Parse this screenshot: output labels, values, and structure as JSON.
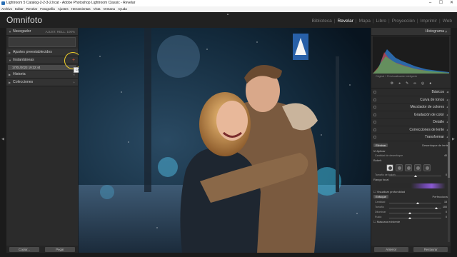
{
  "window": {
    "title": "Lightroom 5 Catalog-2-2-3-2.lrcat - Adobe Photoshop Lightroom Classic - Revelar",
    "controls": [
      "–",
      "☐",
      "✕"
    ]
  },
  "menu": [
    "Archivo",
    "Editar",
    "Revelar",
    "Fotografía",
    "Ajustes",
    "Herramientas",
    "Vista",
    "Ventana",
    "Ayuda"
  ],
  "brand": "Omnifoto",
  "modules": [
    {
      "label": "Biblioteca",
      "active": false
    },
    {
      "label": "Revelar",
      "active": true
    },
    {
      "label": "Mapa",
      "active": false
    },
    {
      "label": "Libro",
      "active": false
    },
    {
      "label": "Proyección",
      "active": false
    },
    {
      "label": "Imprimir",
      "active": false
    },
    {
      "label": "Web",
      "active": false
    }
  ],
  "left_panel": {
    "navigator": {
      "label": "Navegador",
      "zoom_options": "AJUST.  RELL.  100%"
    },
    "presets": {
      "label": "Ajustes preestablecidos"
    },
    "snapshots": {
      "label": "Instantáneas",
      "add_symbol": "+",
      "items": [
        {
          "label": "17/01/2023 19:32:44"
        }
      ]
    },
    "history": {
      "label": "Historia",
      "clear_symbol": "×"
    },
    "collections": {
      "label": "Colecciones",
      "add_symbol": "+"
    },
    "tooltip": "Crear instantánea",
    "copy_button": "Copiar...",
    "paste_button": "Pegar"
  },
  "right_panel": {
    "histogram": {
      "label": "Histograma",
      "caption": "Original + Previsualización inteligente"
    },
    "tools": [
      "⚙",
      "⌖",
      "✎",
      "∞",
      "◎",
      "●"
    ],
    "sections": [
      {
        "label": "Básicos"
      },
      {
        "label": "Curva de tonos"
      },
      {
        "label": "Mezclador de colores"
      },
      {
        "label": "Gradación de color"
      },
      {
        "label": "Detalle"
      },
      {
        "label": "Correcciones de lente"
      },
      {
        "label": "Transformar"
      }
    ],
    "detail_panel": {
      "tab_active": "Eliminar",
      "section_label": "Desenfoque de lente",
      "apply_label": "Aplicar",
      "amount_label": "Cantidad de desenfoque",
      "amount_value": "40",
      "bokeh_label": "Bokeh",
      "focal_range_label": "Rango focal",
      "visualize_label": "Visualizar profundidad",
      "refine_label": "Perfeccionar",
      "sliders": [
        {
          "label": "Tamaño de bokeh",
          "value": "0",
          "fraction": 0.5
        },
        {
          "label": "Cantidad",
          "value": "15",
          "fraction": 0.55
        },
        {
          "label": "Tamaño",
          "value": "100",
          "fraction": 0.9
        },
        {
          "label": "Difuminar",
          "value": "0",
          "fraction": 0.4
        },
        {
          "label": "Ruido",
          "value": "0",
          "fraction": 0.4
        }
      ],
      "focus_label": "Enfoque",
      "mask_label": "Máscara existente",
      "chips": 5
    },
    "prev_button": "Anterior",
    "reset_button": "Restaurar"
  }
}
